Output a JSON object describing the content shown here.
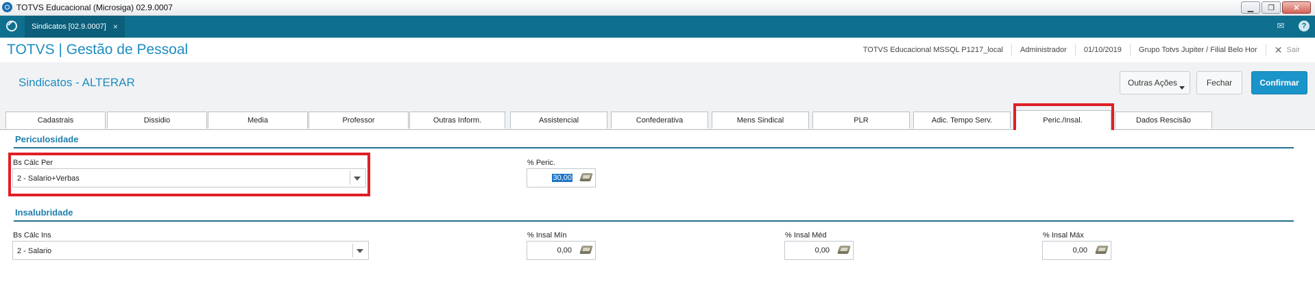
{
  "window": {
    "title": "TOTVS Educacional (Microsiga) 02.9.0007"
  },
  "apptab": {
    "label": "Sindicatos [02.9.0007]",
    "close": "×"
  },
  "header": {
    "brand": "TOTVS | Gestão de Pessoal",
    "environment": "TOTVS Educacional MSSQL P1217_local",
    "user": "Administrador",
    "date": "01/10/2019",
    "branch": "Grupo Totvs Jupiter / Filial Belo Hor",
    "exit_label": "Sair"
  },
  "page": {
    "title": "Sindicatos - ALTERAR",
    "actions": {
      "other": "Outras Ações",
      "close": "Fechar",
      "confirm": "Confirmar"
    }
  },
  "tabs": [
    {
      "label": "Cadastrais"
    },
    {
      "label": "Dissidio"
    },
    {
      "label": "Media"
    },
    {
      "label": "Professor"
    },
    {
      "label": "Outras Inform."
    },
    {
      "label": "Assistencial"
    },
    {
      "label": "Confederativa"
    },
    {
      "label": "Mens Sindical"
    },
    {
      "label": "PLR"
    },
    {
      "label": "Adic. Tempo Serv."
    },
    {
      "label": "Peric./Insal.",
      "active": true
    },
    {
      "label": "Dados Rescisão"
    }
  ],
  "periculosidade": {
    "section_title": "Periculosidade",
    "bs_calc_label": "Bs Cálc Per",
    "bs_calc_value": "2 - Salario+Verbas",
    "perc_label": "% Peric.",
    "perc_value": "30,00"
  },
  "insalubridade": {
    "section_title": "Insalubridade",
    "bs_calc_label": "Bs Cálc Ins",
    "bs_calc_value": "2 - Salario",
    "min_label": "% Insal Mín",
    "min_value": "0,00",
    "med_label": "% Insal Méd",
    "med_value": "0,00",
    "max_label": "% Insal Máx",
    "max_value": "0,00"
  },
  "colors": {
    "accent": "#1d8cc1",
    "strip": "#0e6f8f",
    "confirm": "#1a94c9",
    "highlight": "#e01f26"
  }
}
